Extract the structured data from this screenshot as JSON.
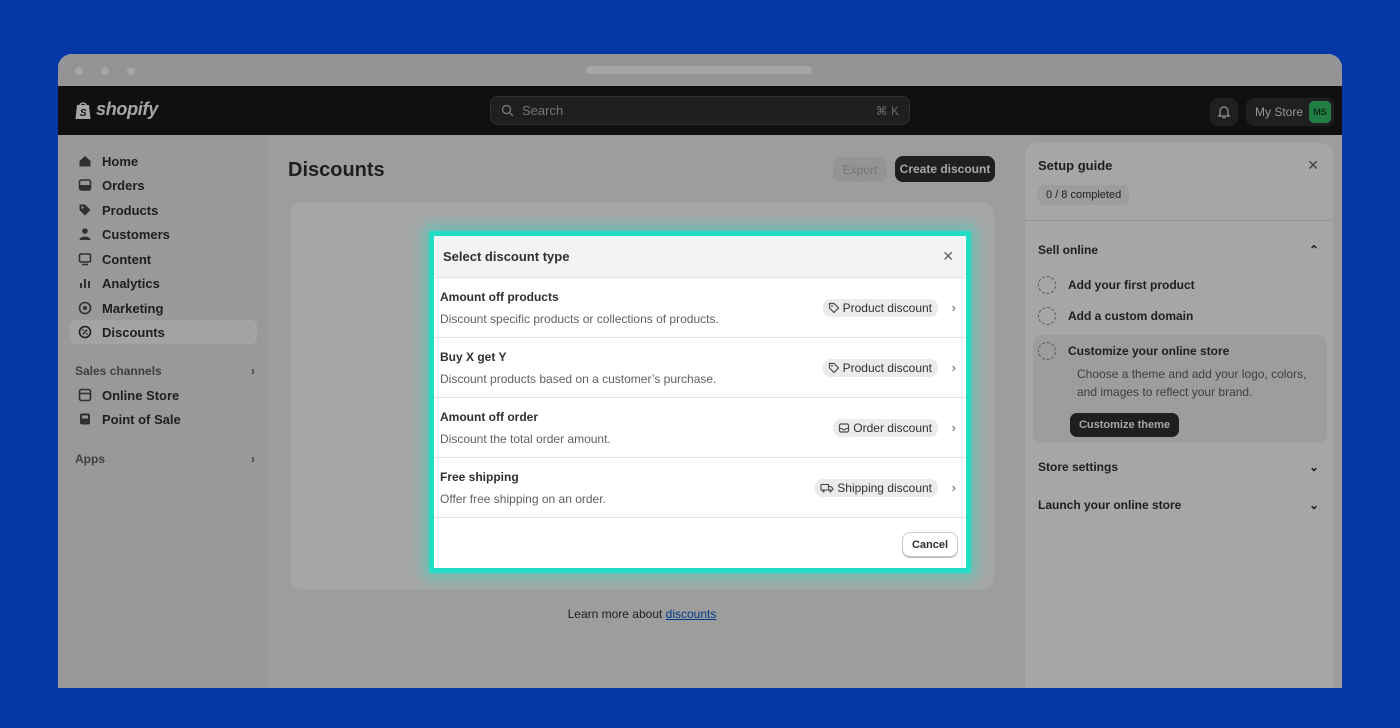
{
  "app": {
    "brand": "shopify",
    "search_placeholder": "Search",
    "search_shortcut": "⌘ K",
    "store_name": "My Store",
    "avatar_initials": "MS"
  },
  "sidebar": {
    "items": [
      {
        "label": "Home",
        "icon": "home-icon"
      },
      {
        "label": "Orders",
        "icon": "orders-icon"
      },
      {
        "label": "Products",
        "icon": "tag-icon"
      },
      {
        "label": "Customers",
        "icon": "person-icon"
      },
      {
        "label": "Content",
        "icon": "content-icon"
      },
      {
        "label": "Analytics",
        "icon": "bar-chart-icon"
      },
      {
        "label": "Marketing",
        "icon": "target-icon"
      },
      {
        "label": "Discounts",
        "icon": "discount-icon",
        "active": true
      }
    ],
    "sales_channels_label": "Sales channels",
    "channels": [
      {
        "label": "Online Store",
        "icon": "store-icon"
      },
      {
        "label": "Point of Sale",
        "icon": "pos-icon"
      }
    ],
    "apps_label": "Apps"
  },
  "main": {
    "title": "Discounts",
    "export_label": "Export",
    "create_label": "Create discount",
    "learn_prefix": "Learn more about ",
    "learn_link": "discounts"
  },
  "setup_guide": {
    "title": "Setup guide",
    "progress": "0 / 8 completed",
    "sell_online": "Sell online",
    "tasks": [
      {
        "label": "Add your first product"
      },
      {
        "label": "Add a custom domain"
      },
      {
        "label": "Customize your online store",
        "description": "Choose a theme and add your logo, colors, and images to reflect your brand.",
        "button": "Customize theme"
      }
    ],
    "store_settings": "Store settings",
    "launch": "Launch your online store"
  },
  "modal": {
    "title": "Select discount type",
    "options": [
      {
        "title": "Amount off products",
        "description": "Discount specific products or collections of products.",
        "badge": "Product discount",
        "badge_icon": "tag-icon"
      },
      {
        "title": "Buy X get Y",
        "description": "Discount products based on a customer’s purchase.",
        "badge": "Product discount",
        "badge_icon": "tag-icon"
      },
      {
        "title": "Amount off order",
        "description": "Discount the total order amount.",
        "badge": "Order discount",
        "badge_icon": "inbox-icon"
      },
      {
        "title": "Free shipping",
        "description": "Offer free shipping on an order.",
        "badge": "Shipping discount",
        "badge_icon": "truck-icon"
      }
    ],
    "cancel_label": "Cancel"
  },
  "colors": {
    "background": "#0637a6",
    "highlight": "#22ddc6",
    "topbar": "#1a1a1a",
    "avatar": "#36c26a"
  }
}
